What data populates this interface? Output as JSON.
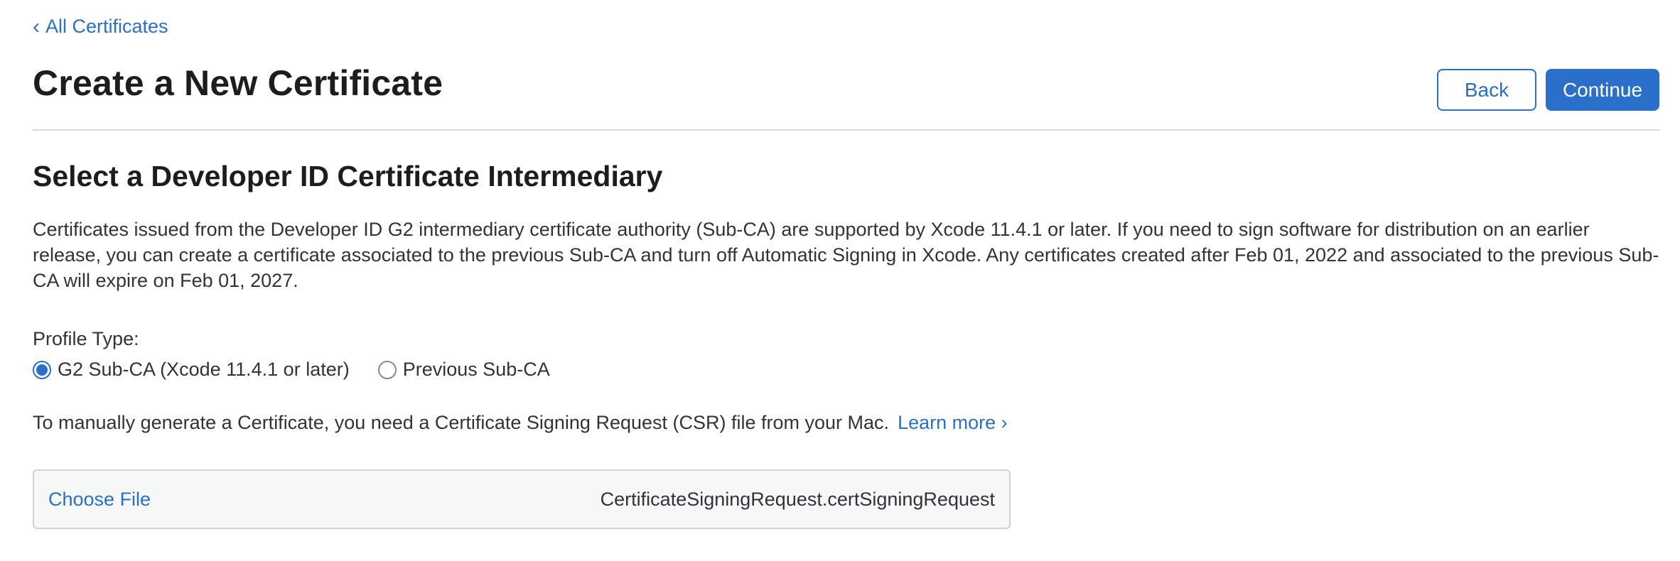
{
  "nav": {
    "back_link": "All Certificates",
    "back_chevron": "‹"
  },
  "header": {
    "title": "Create a New Certificate",
    "back_button": "Back",
    "continue_button": "Continue"
  },
  "section": {
    "title": "Select a Developer ID Certificate Intermediary",
    "description": "Certificates issued from the Developer ID G2 intermediary certificate authority (Sub-CA) are supported by Xcode 11.4.1 or later. If you need to sign software for distribution on an earlier release, you can create a certificate associated to the previous Sub-CA and turn off Automatic Signing in Xcode. Any certificates created after Feb 01, 2022 and associated to the previous Sub-CA will expire on Feb 01, 2027."
  },
  "profile_type": {
    "label": "Profile Type:",
    "options": [
      {
        "label": "G2 Sub-CA (Xcode 11.4.1 or later)",
        "selected": true
      },
      {
        "label": "Previous Sub-CA",
        "selected": false
      }
    ]
  },
  "csr": {
    "text": "To manually generate a Certificate, you need a Certificate Signing Request (CSR) file from your Mac.",
    "learn_more": "Learn more ›",
    "choose_file": "Choose File",
    "file_name": "CertificateSigningRequest.certSigningRequest"
  },
  "colors": {
    "accent": "#2a6fc9",
    "divider": "#d9d9de",
    "file_box_bg": "#f6f7f7"
  }
}
